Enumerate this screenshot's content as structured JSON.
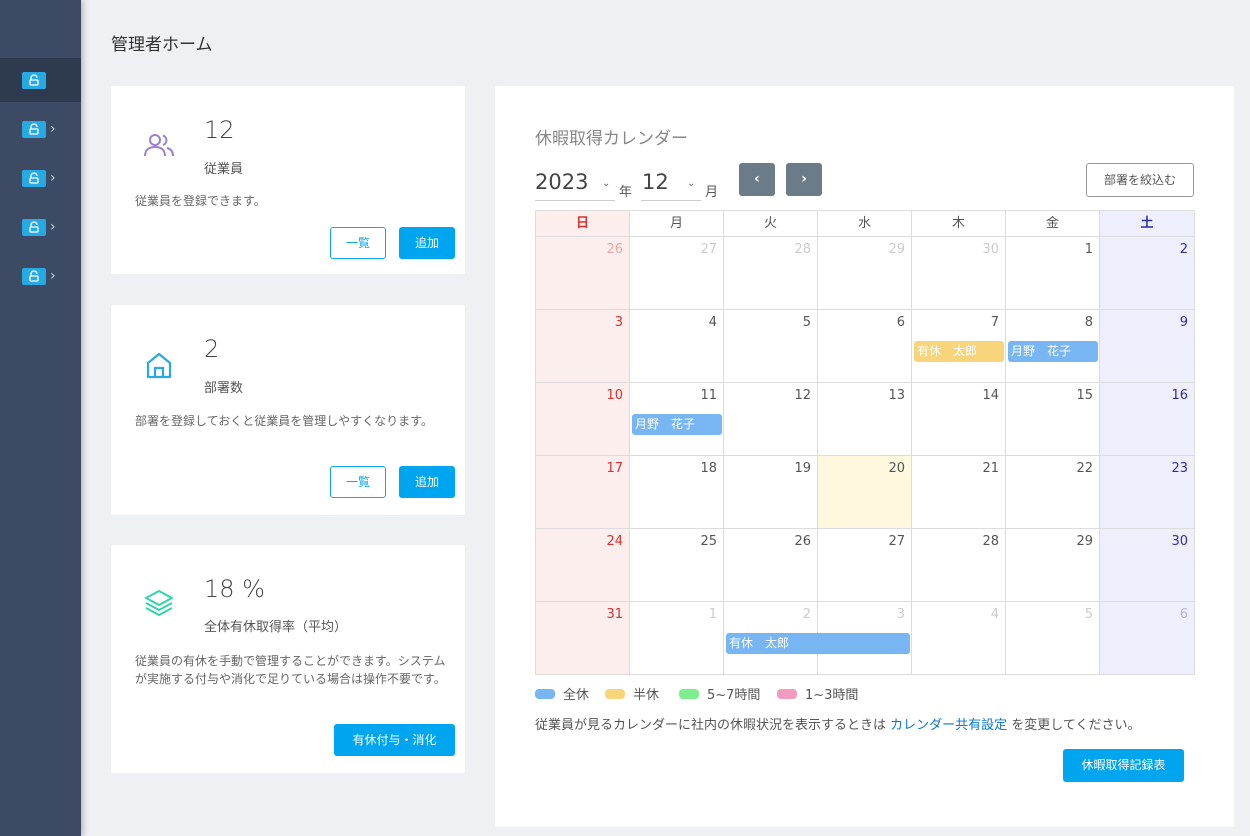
{
  "page": {
    "title": "管理者ホーム"
  },
  "colors": {
    "sidebar": "#3d4a63",
    "accent": "#00a5ef",
    "sunday": "#d9322e",
    "saturday": "#2f2f9e",
    "today": "#fdf8de"
  },
  "sidebar": {
    "items": [
      {
        "icon": "lock-icon",
        "active": true
      },
      {
        "icon": "lock-icon",
        "chevron": "›"
      },
      {
        "icon": "lock-icon",
        "chevron": "›"
      },
      {
        "icon": "lock-icon",
        "chevron": "›"
      },
      {
        "icon": "lock-icon",
        "chevron": "›"
      }
    ]
  },
  "cards": {
    "employees": {
      "icon": "users-icon",
      "count": "12",
      "label": "従業員",
      "description": "従業員を登録できます。",
      "list_btn": "一覧",
      "add_btn": "追加"
    },
    "departments": {
      "icon": "home-icon",
      "count": "2",
      "label": "部署数",
      "description": "部署を登録しておくと従業員を管理しやすくなります。",
      "list_btn": "一覧",
      "add_btn": "追加"
    },
    "leave": {
      "icon": "layers-icon",
      "count": "18 %",
      "label": "全体有休取得率（平均）",
      "description": "従業員の有休を手動で管理することができます。システムが実施する付与や消化で足りている場合は操作不要です。",
      "action_btn": "有休付与・消化"
    }
  },
  "calendar": {
    "title": "休暇取得カレンダー",
    "year": "2023",
    "year_unit": "年",
    "month": "12",
    "month_unit": "月",
    "prev": "‹",
    "next": "›",
    "caret": "⌄",
    "filter_btn": "部署を絞込む",
    "weekdays": [
      "日",
      "月",
      "火",
      "水",
      "木",
      "金",
      "土"
    ],
    "weeks": [
      [
        "26",
        "27",
        "28",
        "29",
        "30",
        "1",
        "2"
      ],
      [
        "3",
        "4",
        "5",
        "6",
        "7",
        "8",
        "9"
      ],
      [
        "10",
        "11",
        "12",
        "13",
        "14",
        "15",
        "16"
      ],
      [
        "17",
        "18",
        "19",
        "20",
        "21",
        "22",
        "23"
      ],
      [
        "24",
        "25",
        "26",
        "27",
        "28",
        "29",
        "30"
      ],
      [
        "31",
        "1",
        "2",
        "3",
        "4",
        "5",
        "6"
      ]
    ],
    "other_month": [
      [
        0,
        0
      ],
      [
        0,
        1
      ],
      [
        0,
        2
      ],
      [
        0,
        3
      ],
      [
        0,
        4
      ],
      [
        5,
        1
      ],
      [
        5,
        2
      ],
      [
        5,
        3
      ],
      [
        5,
        4
      ],
      [
        5,
        5
      ],
      [
        5,
        6
      ]
    ],
    "today": [
      3,
      3
    ],
    "events": [
      {
        "week": 1,
        "start": 4,
        "span": 1,
        "label": "有休　太郎",
        "type": "half"
      },
      {
        "week": 1,
        "start": 5,
        "span": 1,
        "label": "月野　花子",
        "type": "full"
      },
      {
        "week": 2,
        "start": 1,
        "span": 1,
        "label": "月野　花子",
        "type": "full"
      },
      {
        "week": 5,
        "start": 2,
        "span": 2,
        "label": "有休　太郎",
        "type": "full"
      }
    ],
    "legend": [
      {
        "label": "全休",
        "color": "#77b6f3"
      },
      {
        "label": "半休",
        "color": "#f8d47a"
      },
      {
        "label": "5~7時間",
        "color": "#7ded8e"
      },
      {
        "label": "1~3時間",
        "color": "#f49cbf"
      }
    ],
    "note_before": "従業員が見るカレンダーに社内の休暇状況を表示するときは ",
    "note_link": "カレンダー共有設定",
    "note_after": " を変更してください。",
    "record_btn": "休暇取得記録表"
  }
}
